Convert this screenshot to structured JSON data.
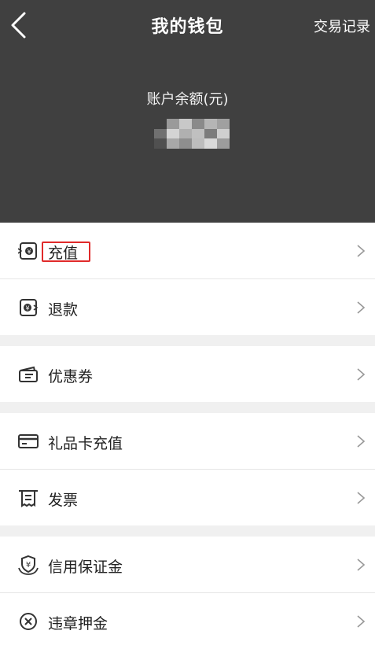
{
  "header": {
    "title": "我的钱包",
    "records_link": "交易记录",
    "balance_label": "账户余额(元)",
    "balance_value_state": "pixelated"
  },
  "menu": {
    "recharge": {
      "label": "充值",
      "icon": "recharge-icon"
    },
    "refund": {
      "label": "退款",
      "icon": "refund-icon"
    },
    "coupons": {
      "label": "优惠券",
      "icon": "coupon-icon"
    },
    "gift_card": {
      "label": "礼品卡充值",
      "icon": "card-icon"
    },
    "invoice": {
      "label": "发票",
      "icon": "receipt-icon"
    },
    "credit_deposit": {
      "label": "信用保证金",
      "icon": "shield-yen-icon"
    },
    "partial": {
      "label": "违章押金",
      "icon": "circle-x-icon"
    }
  },
  "colors": {
    "header_bg": "#404040",
    "highlight_border": "#e02a2a",
    "page_bg": "#f0f0f0"
  }
}
